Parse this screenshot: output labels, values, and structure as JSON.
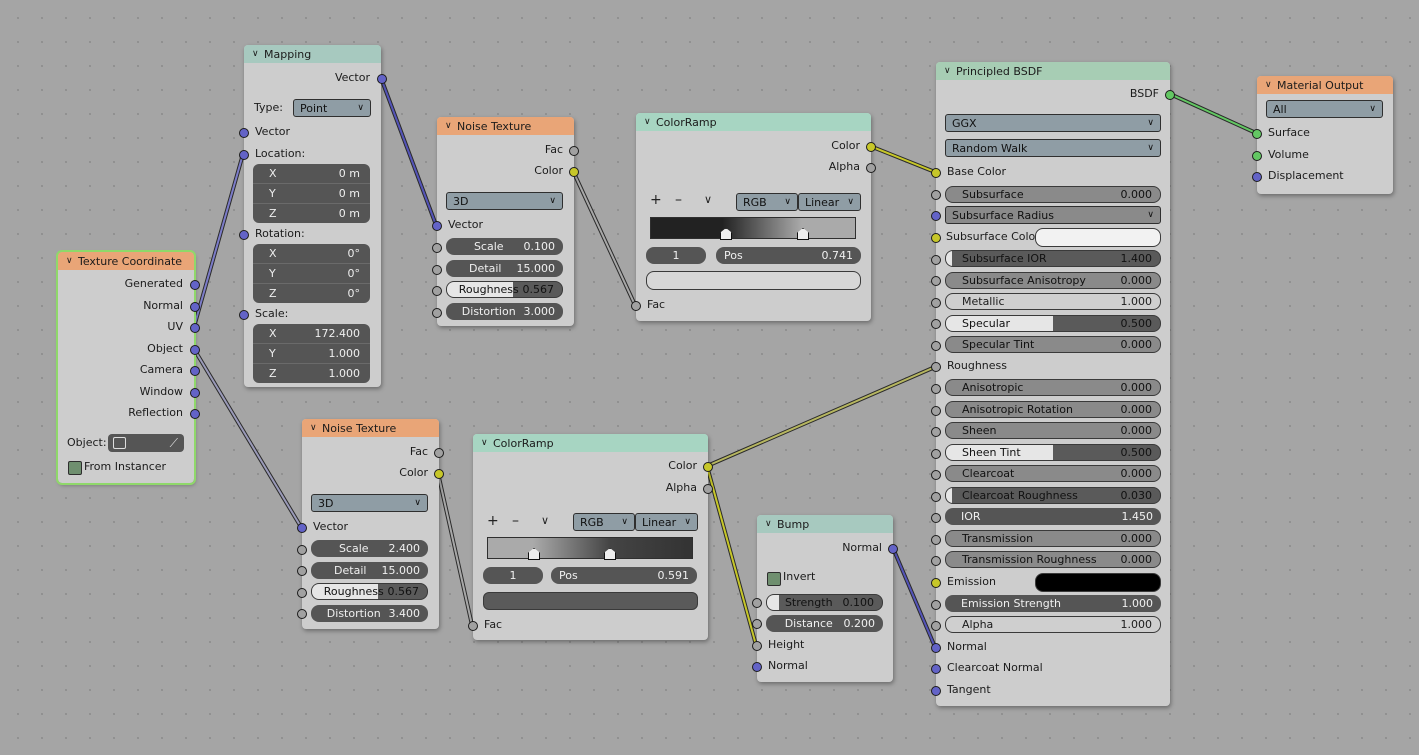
{
  "nodes": {
    "texcoord": {
      "title": "Texture Coordinate",
      "outputs": [
        "Generated",
        "Normal",
        "UV",
        "Object",
        "Camera",
        "Window",
        "Reflection"
      ],
      "object_label": "Object:",
      "from_instancer": "From Instancer"
    },
    "mapping": {
      "title": "Mapping",
      "out_vector": "Vector",
      "type_label": "Type:",
      "type_value": "Point",
      "in_vector": "Vector",
      "location_label": "Location:",
      "location": [
        [
          "X",
          "0 m"
        ],
        [
          "Y",
          "0 m"
        ],
        [
          "Z",
          "0 m"
        ]
      ],
      "rotation_label": "Rotation:",
      "rotation": [
        [
          "X",
          "0°"
        ],
        [
          "Y",
          "0°"
        ],
        [
          "Z",
          "0°"
        ]
      ],
      "scale_label": "Scale:",
      "scale": [
        [
          "X",
          "172.400"
        ],
        [
          "Y",
          "1.000"
        ],
        [
          "Z",
          "1.000"
        ]
      ]
    },
    "noise1": {
      "title": "Noise Texture",
      "out_fac": "Fac",
      "out_color": "Color",
      "dim": "3D",
      "in_vector": "Vector",
      "scale_label": "Scale",
      "scale": "0.100",
      "detail_label": "Detail",
      "detail": "15.000",
      "roughness_label": "Roughness",
      "roughness": "0.567",
      "distortion_label": "Distortion",
      "distortion": "3.000"
    },
    "noise2": {
      "title": "Noise Texture",
      "out_fac": "Fac",
      "out_color": "Color",
      "dim": "3D",
      "in_vector": "Vector",
      "scale_label": "Scale",
      "scale": "2.400",
      "detail_label": "Detail",
      "detail": "15.000",
      "roughness_label": "Roughness",
      "roughness": "0.567",
      "distortion_label": "Distortion",
      "distortion": "3.400"
    },
    "ramp1": {
      "title": "ColorRamp",
      "out_color": "Color",
      "out_alpha": "Alpha",
      "plus": "+",
      "minus": "–",
      "down": "∨",
      "mode": "RGB",
      "interp": "Linear",
      "index": "1",
      "pos_label": "Pos",
      "pos": "0.741",
      "in_fac": "Fac"
    },
    "ramp2": {
      "title": "ColorRamp",
      "out_color": "Color",
      "out_alpha": "Alpha",
      "plus": "+",
      "minus": "–",
      "down": "∨",
      "mode": "RGB",
      "interp": "Linear",
      "index": "1",
      "pos_label": "Pos",
      "pos": "0.591",
      "in_fac": "Fac"
    },
    "bump": {
      "title": "Bump",
      "out_normal": "Normal",
      "invert": "Invert",
      "strength_label": "Strength",
      "strength": "0.100",
      "distance_label": "Distance",
      "distance": "0.200",
      "in_height": "Height",
      "in_normal": "Normal"
    },
    "bsdf": {
      "title": "Principled BSDF",
      "out_bsdf": "BSDF",
      "distribution": "GGX",
      "sss_method": "Random Walk",
      "base_color": "Base Color",
      "subsurface_label": "Subsurface",
      "subsurface": "0.000",
      "subsurface_radius": "Subsurface Radius",
      "subsurface_color": "Subsurface Color",
      "subsurface_ior_label": "Subsurface IOR",
      "subsurface_ior": "1.400",
      "subsurface_aniso_label": "Subsurface Anisotropy",
      "subsurface_aniso": "0.000",
      "metallic_label": "Metallic",
      "metallic": "1.000",
      "specular_label": "Specular",
      "specular": "0.500",
      "specular_tint_label": "Specular Tint",
      "specular_tint": "0.000",
      "roughness": "Roughness",
      "anisotropic_label": "Anisotropic",
      "anisotropic": "0.000",
      "aniso_rot_label": "Anisotropic Rotation",
      "aniso_rot": "0.000",
      "sheen_label": "Sheen",
      "sheen": "0.000",
      "sheen_tint_label": "Sheen Tint",
      "sheen_tint": "0.500",
      "clearcoat_label": "Clearcoat",
      "clearcoat": "0.000",
      "clearcoat_rough_label": "Clearcoat Roughness",
      "clearcoat_rough": "0.030",
      "ior_label": "IOR",
      "ior": "1.450",
      "transmission_label": "Transmission",
      "transmission": "0.000",
      "trans_rough_label": "Transmission Roughness",
      "trans_rough": "0.000",
      "emission": "Emission",
      "emission_strength_label": "Emission Strength",
      "emission_strength": "1.000",
      "alpha_label": "Alpha",
      "alpha": "1.000",
      "normal": "Normal",
      "clearcoat_normal": "Clearcoat Normal",
      "tangent": "Tangent"
    },
    "output": {
      "title": "Material Output",
      "target": "All",
      "surface": "Surface",
      "volume": "Volume",
      "displacement": "Displacement"
    }
  },
  "colors": {
    "vector_socket": "#6363c7",
    "color_socket": "#c7c729",
    "float_socket": "#a1a1a1",
    "shader_socket": "#63c763",
    "texture_header": "#e9a577",
    "converter_header": "#a7d5c2"
  }
}
